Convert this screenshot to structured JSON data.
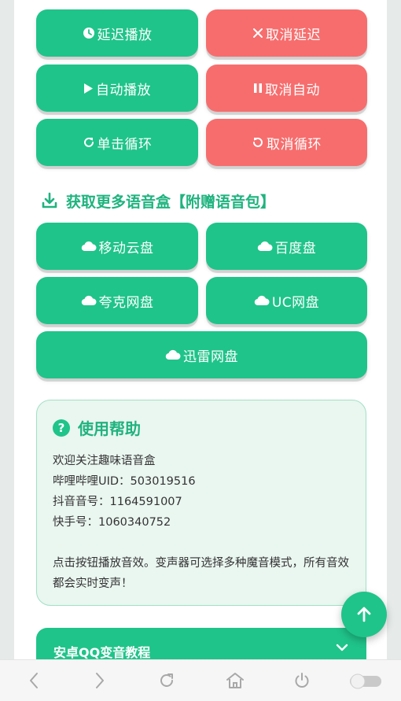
{
  "controls": {
    "delay_play": "延迟播放",
    "cancel_delay": "取消延迟",
    "auto_play": "自动播放",
    "cancel_auto": "取消自动",
    "single_loop": "单击循环",
    "cancel_loop": "取消循环"
  },
  "more_section": {
    "title": "获取更多语音盒【附赠语音包】",
    "links": [
      "移动云盘",
      "百度盘",
      "夸克网盘",
      "UC网盘",
      "迅雷网盘"
    ]
  },
  "help": {
    "title": "使用帮助",
    "lines": [
      "欢迎关注趣味语音盒",
      "哔哩哔哩UID：503019516",
      "抖音音号：1164591007",
      "快手号：1060340752",
      "",
      "点击按钮播放音效。变声器可选择多种魔音模式，所有音效都会实时变声！"
    ]
  },
  "accordion": {
    "label": "安卓QQ变音教程"
  },
  "colors": {
    "green": "#1fc48a",
    "red": "#f76d6d",
    "title_green": "#1fb37f"
  },
  "icons": {
    "delay_play": "clock-icon",
    "cancel_delay": "x-icon",
    "auto_play": "play-icon",
    "cancel_auto": "pause-icon",
    "single_loop": "redo-icon",
    "cancel_loop": "undo-icon",
    "cloud": "cloud-icon",
    "section": "download-icon",
    "help": "question-icon"
  }
}
